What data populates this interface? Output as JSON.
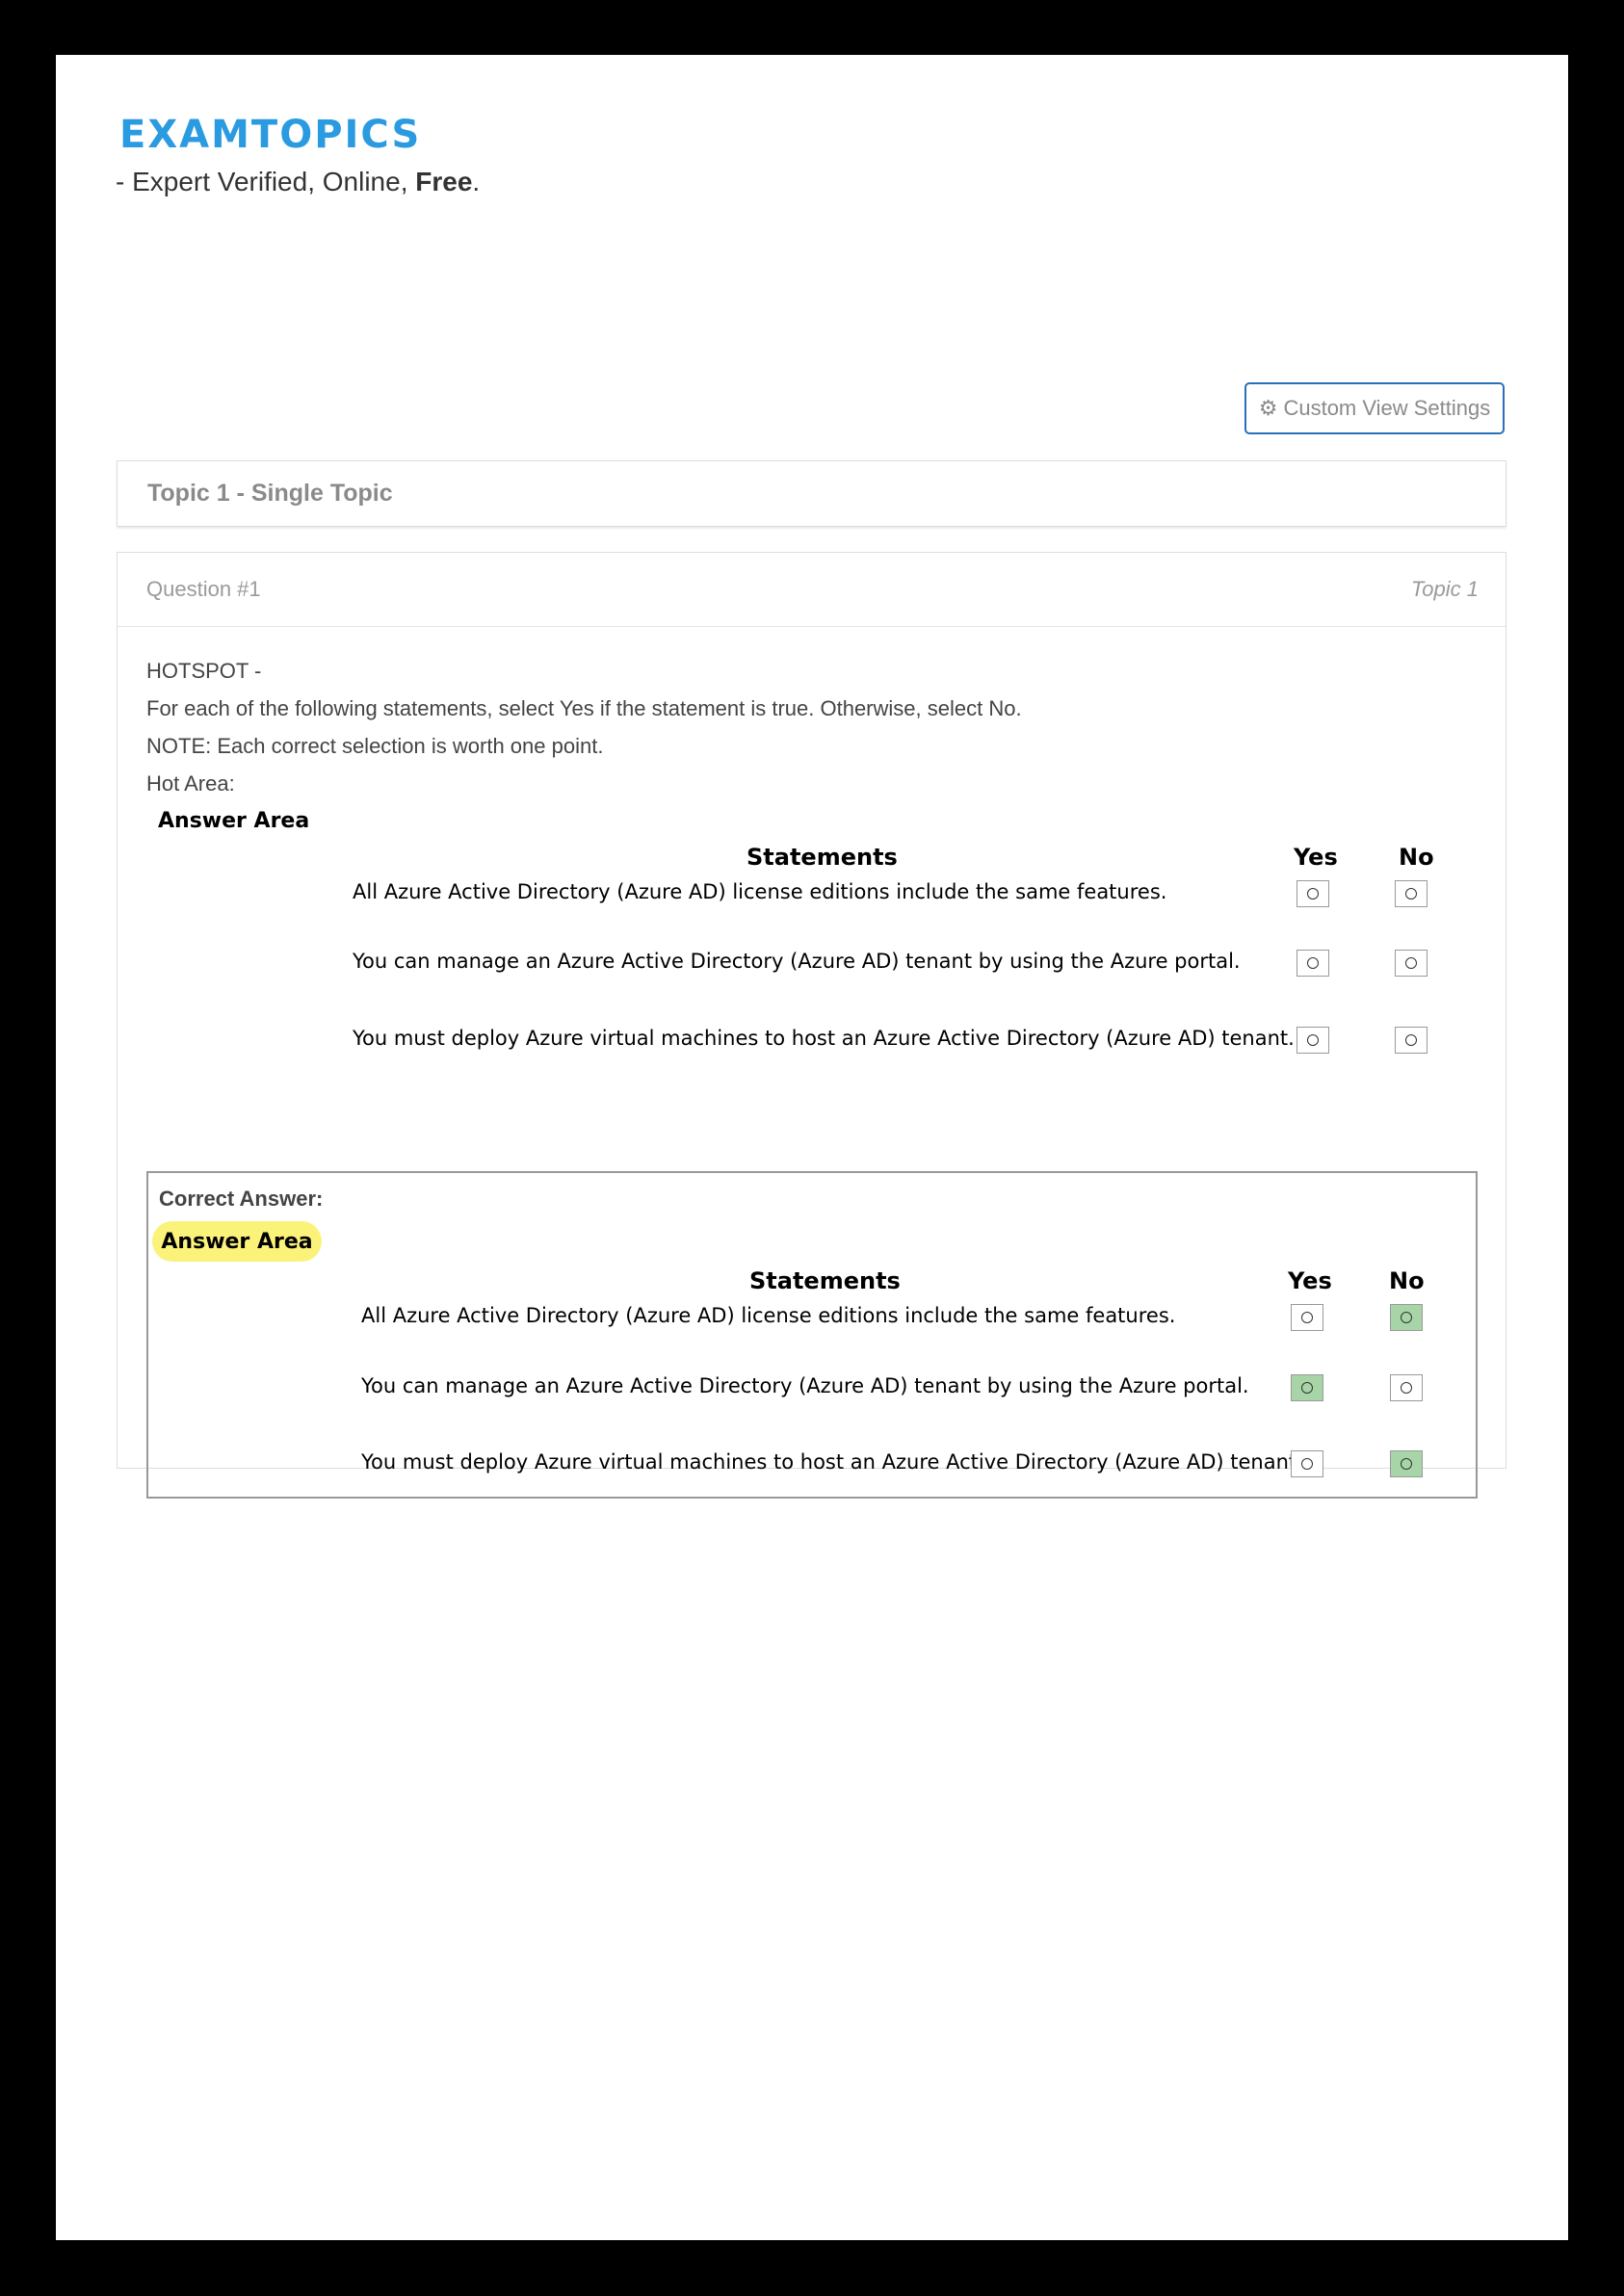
{
  "brand": {
    "logo_text": "EXAMTOPICS"
  },
  "tagline": {
    "prefix": "- Expert Verified, Online, ",
    "bold": "Free",
    "suffix": "."
  },
  "toolbar": {
    "custom_view_label": "Custom View Settings",
    "custom_view_icon": "gear-icon"
  },
  "topic_header": "Topic 1 - Single Topic",
  "question": {
    "number_label": "Question #1",
    "topic_label": "Topic 1",
    "lines": [
      "HOTSPOT -",
      "For each of the following statements, select Yes if the statement is true. Otherwise, select No.",
      "NOTE: Each correct selection is worth one point.",
      "Hot Area:"
    ]
  },
  "answer_area": {
    "title": "Answer Area",
    "col_statements": "Statements",
    "col_yes": "Yes",
    "col_no": "No",
    "statements": [
      "All Azure Active Directory (Azure AD) license editions include the same features.",
      "You can manage an Azure Active Directory (Azure AD) tenant by using the Azure portal.",
      "You must deploy Azure virtual machines to host an Azure Active Directory (Azure AD) tenant."
    ]
  },
  "correct_answer": {
    "label": "Correct Answer:",
    "title": "Answer Area",
    "col_statements": "Statements",
    "col_yes": "Yes",
    "col_no": "No",
    "statements": [
      "All Azure Active Directory (Azure AD) license editions include the same features.",
      "You can manage an Azure Active Directory (Azure AD) tenant by using the Azure portal.",
      "You must deploy Azure virtual machines to host an Azure Active Directory (Azure AD) tenant."
    ],
    "selected": [
      "No",
      "Yes",
      "No"
    ],
    "highlight_color": "#a8d5a8",
    "title_highlight_color": "#fbf27a"
  },
  "colors": {
    "brand_blue": "#2a9be0",
    "button_border": "#2a6fb7"
  }
}
